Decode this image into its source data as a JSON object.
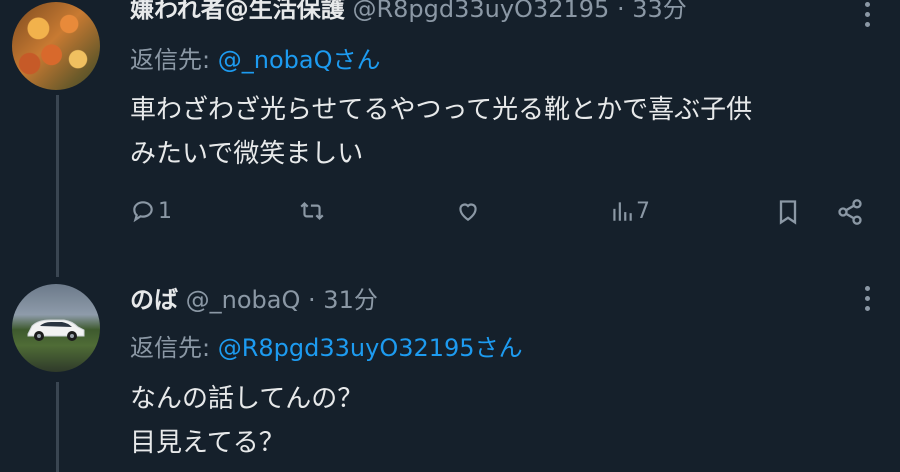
{
  "tweets": [
    {
      "display_name": "嫌われ者@生活保護",
      "handle": "@R8pgd33uyO32195",
      "separator": "·",
      "time": "33分",
      "reply_label": "返信先:",
      "reply_handle": "@_nobaQさん",
      "body_lines": [
        "車わざわざ光らせてるやつって光る靴とかで喜ぶ子供",
        "みたいで微笑ましい"
      ],
      "actions": {
        "reply_count": "1",
        "views_count": "7"
      }
    },
    {
      "display_name": "のば",
      "handle": "@_nobaQ",
      "separator": "·",
      "time": "31分",
      "reply_label": "返信先:",
      "reply_handle": "@R8pgd33uyO32195さん",
      "body_lines": [
        "なんの話してんの？",
        "目見えてる？"
      ]
    }
  ],
  "icons": {
    "avatar_1": "autumn-leaves-avatar",
    "avatar_2": "white-car-avatar",
    "reply": "reply-icon",
    "retweet": "retweet-icon",
    "like": "heart-icon",
    "views": "views-chart-icon",
    "bookmark": "bookmark-icon",
    "share": "share-icon",
    "more": "more-vertical-icon"
  },
  "colors": {
    "background": "#15202b",
    "text": "#e7e9ea",
    "muted": "#8b98a5",
    "link": "#1d9bf0",
    "thread_line": "#3a4652"
  }
}
